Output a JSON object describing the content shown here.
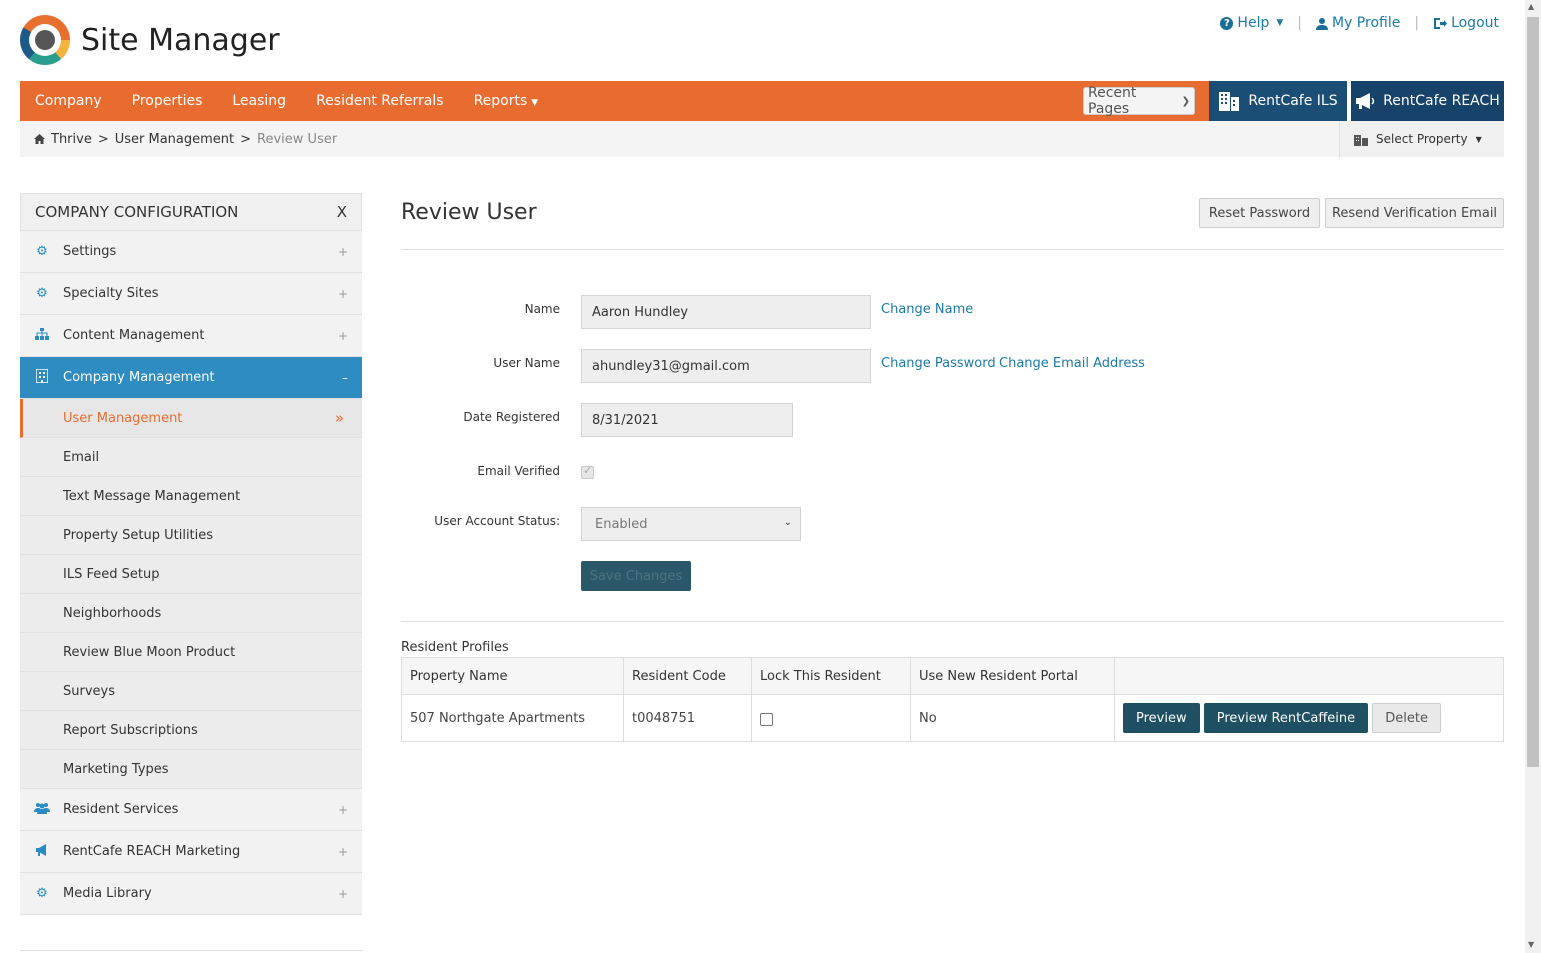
{
  "app": {
    "title": "Site Manager"
  },
  "top_links": {
    "help": "Help",
    "profile": "My Profile",
    "logout": "Logout"
  },
  "nav": {
    "items": [
      "Company",
      "Properties",
      "Leasing",
      "Resident Referrals",
      "Reports"
    ],
    "recent_pages": "Recent Pages",
    "ils": "RentCafe ILS",
    "reach": "RentCafe REACH"
  },
  "breadcrumb": {
    "root": "Thrive",
    "parent": "User Management",
    "current": "Review User",
    "sep": ">"
  },
  "select_property": "Select Property",
  "sidebar": {
    "header": "COMPANY CONFIGURATION",
    "close": "X",
    "items_top": [
      "Settings",
      "Specialty Sites",
      "Content Management",
      "Company Management"
    ],
    "sub_items": [
      "User Management",
      "Email",
      "Text Message Management",
      "Property Setup Utilities",
      "ILS Feed Setup",
      "Neighborhoods",
      "Review Blue Moon Product",
      "Surveys",
      "Report Subscriptions",
      "Marketing Types"
    ],
    "items_bottom": [
      "Resident Services",
      "RentCafe REACH Marketing",
      "Media Library"
    ]
  },
  "page": {
    "title": "Review User",
    "reset_password": "Reset Password",
    "resend_verification": "Resend Verification Email"
  },
  "form": {
    "name_label": "Name",
    "name_value": "Aaron Hundley",
    "change_name": "Change Name",
    "username_label": "User Name",
    "username_value": "ahundley31@gmail.com",
    "change_password": "Change Password",
    "change_email": "Change Email Address",
    "date_label": "Date Registered",
    "date_value": "8/31/2021",
    "email_verified_label": "Email Verified",
    "email_verified": true,
    "status_label": "User Account Status:",
    "status_value": "Enabled",
    "save": "Save Changes"
  },
  "profiles": {
    "section": "Resident Profiles",
    "headers": [
      "Property Name",
      "Resident Code",
      "Lock This Resident",
      "Use New Resident Portal",
      ""
    ],
    "rows": [
      {
        "property": "507 Northgate Apartments",
        "code": "t0048751",
        "locked": false,
        "new_portal": "No"
      }
    ],
    "preview": "Preview",
    "preview_rentcaffeine": "Preview RentCaffeine",
    "delete": "Delete"
  }
}
